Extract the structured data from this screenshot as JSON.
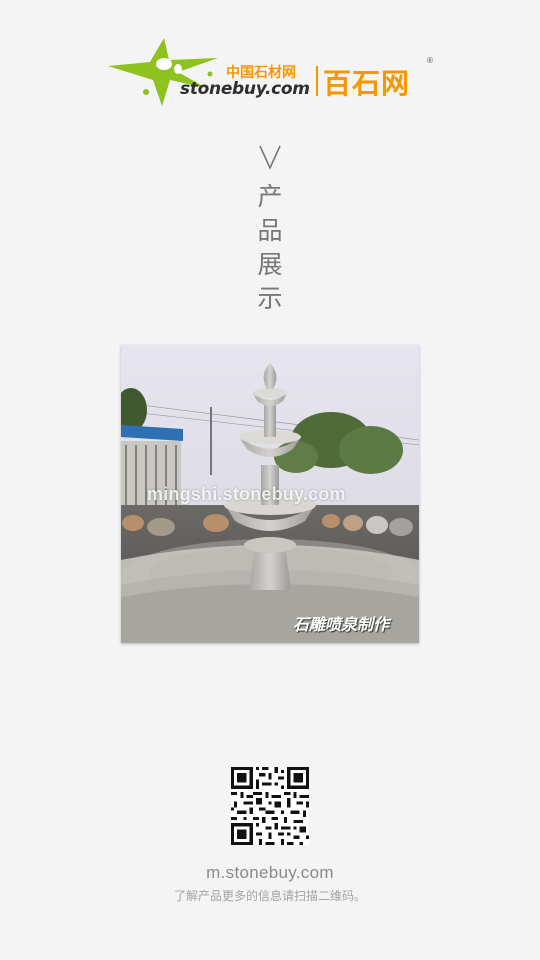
{
  "logo": {
    "cn_small": "中国石材网",
    "en": "stonebuy.com",
    "cn_big": "百石网",
    "reg_mark": "®",
    "brand_green": "#8dc21f",
    "brand_orange": "#f39800"
  },
  "section": {
    "chevron_icon": "chevron-down-icon",
    "title_chars": [
      "产",
      "品",
      "展",
      "示"
    ]
  },
  "product": {
    "watermark": "mingshi.stonebuy.com",
    "caption": "石雕喷泉制作"
  },
  "footer": {
    "url": "m.stonebuy.com",
    "hint": "了解产品更多的信息请扫描二维码。"
  }
}
